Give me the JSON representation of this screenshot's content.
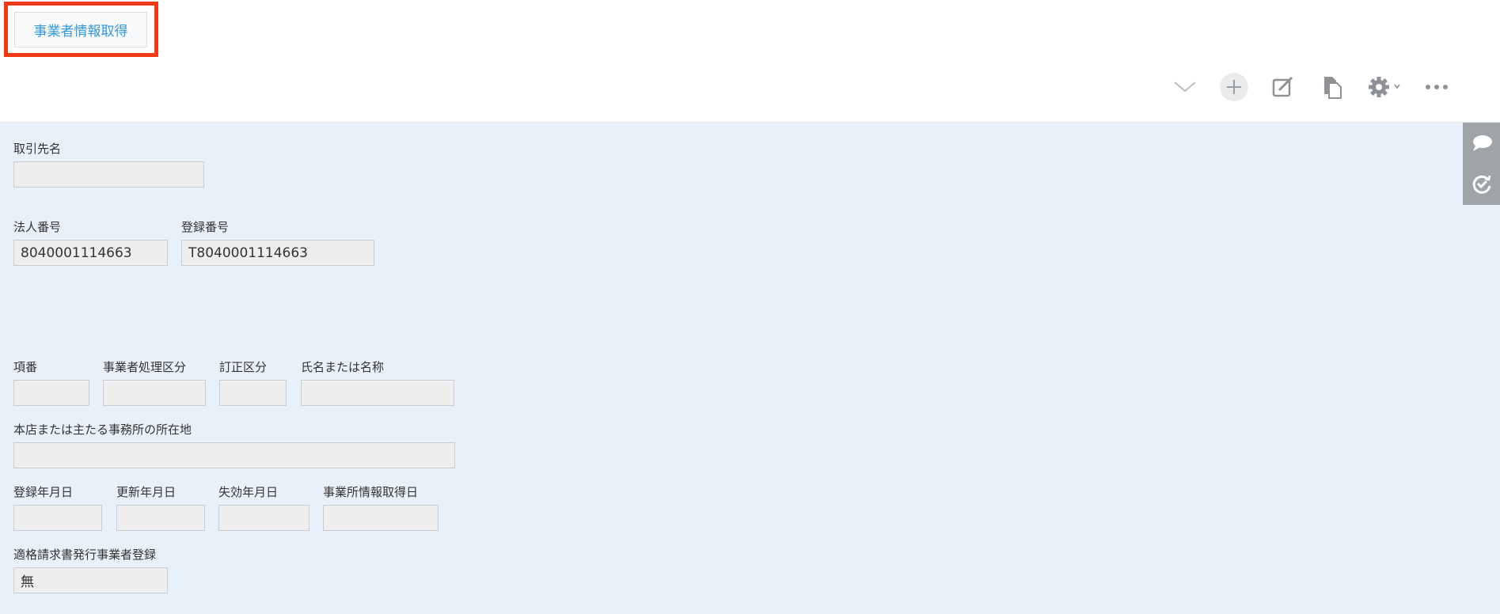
{
  "header": {
    "action_button_label": "事業者情報取得"
  },
  "toolbar": {
    "icons": [
      "chevron-down-icon",
      "plus-icon",
      "edit-icon",
      "copy-icon",
      "gear-icon",
      "more-icon"
    ]
  },
  "side_panel": {
    "icons": [
      "comment-icon",
      "history-icon"
    ]
  },
  "form": {
    "partner_name": {
      "label": "取引先名",
      "value": ""
    },
    "corporate_number": {
      "label": "法人番号",
      "value": "8040001114663"
    },
    "registration_number": {
      "label": "登録番号",
      "value": "T8040001114663"
    },
    "item_number": {
      "label": "項番",
      "value": ""
    },
    "business_process_type": {
      "label": "事業者処理区分",
      "value": ""
    },
    "correction_type": {
      "label": "訂正区分",
      "value": ""
    },
    "name": {
      "label": "氏名または名称",
      "value": ""
    },
    "head_office_address": {
      "label": "本店または主たる事務所の所在地",
      "value": ""
    },
    "registration_date": {
      "label": "登録年月日",
      "value": ""
    },
    "update_date": {
      "label": "更新年月日",
      "value": ""
    },
    "expiration_date": {
      "label": "失効年月日",
      "value": ""
    },
    "office_info_date": {
      "label": "事業所情報取得日",
      "value": ""
    },
    "qualified_invoice_registration": {
      "label": "適格請求書発行事業者登録",
      "value": "無"
    }
  },
  "colors": {
    "content_background": "#e8f1fa",
    "highlight_border": "#f23a16",
    "button_text": "#3498db",
    "field_background": "#eeeeee",
    "side_panel": "#9fa4a8"
  }
}
